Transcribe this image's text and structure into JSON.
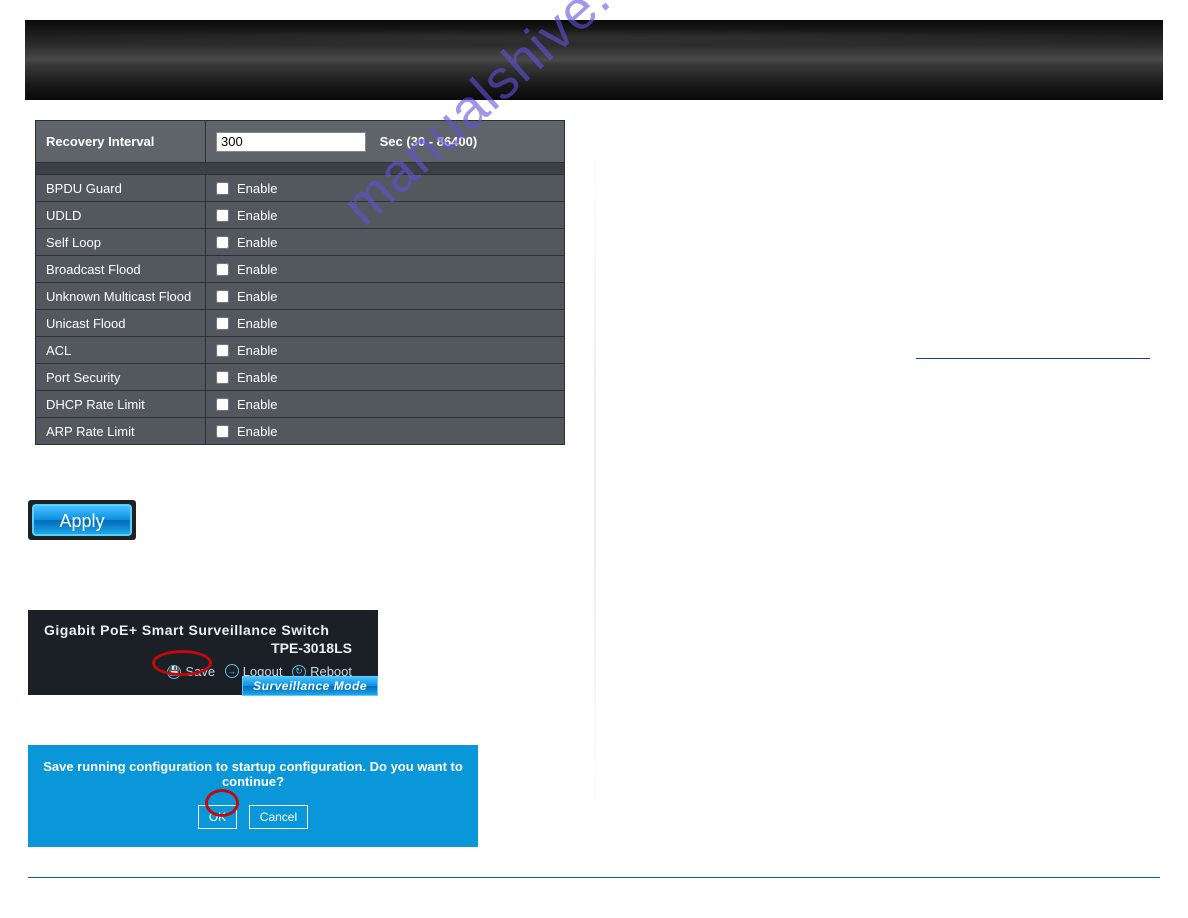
{
  "watermark": "manualshive.com",
  "form": {
    "recovery_interval_label": "Recovery Interval",
    "recovery_interval_value": "300",
    "recovery_interval_hint": "Sec (30 - 86400)",
    "enable_text": "Enable",
    "rows": [
      {
        "label": "BPDU Guard"
      },
      {
        "label": "UDLD"
      },
      {
        "label": "Self Loop"
      },
      {
        "label": "Broadcast Flood"
      },
      {
        "label": "Unknown Multicast Flood"
      },
      {
        "label": "Unicast Flood"
      },
      {
        "label": "ACL"
      },
      {
        "label": "Port Security"
      },
      {
        "label": "DHCP Rate Limit"
      },
      {
        "label": "ARP Rate Limit"
      }
    ]
  },
  "apply_label": "Apply",
  "switch_header": {
    "title": "Gigabit PoE+ Smart Surveillance Switch",
    "model": "TPE-3018LS",
    "save": "Save",
    "logout": "Logout",
    "reboot": "Reboot",
    "surv_mode": "Surveillance Mode"
  },
  "dialog": {
    "message": "Save running configuration to startup configuration. Do you want to continue?",
    "ok": "OK",
    "cancel": "Cancel"
  }
}
